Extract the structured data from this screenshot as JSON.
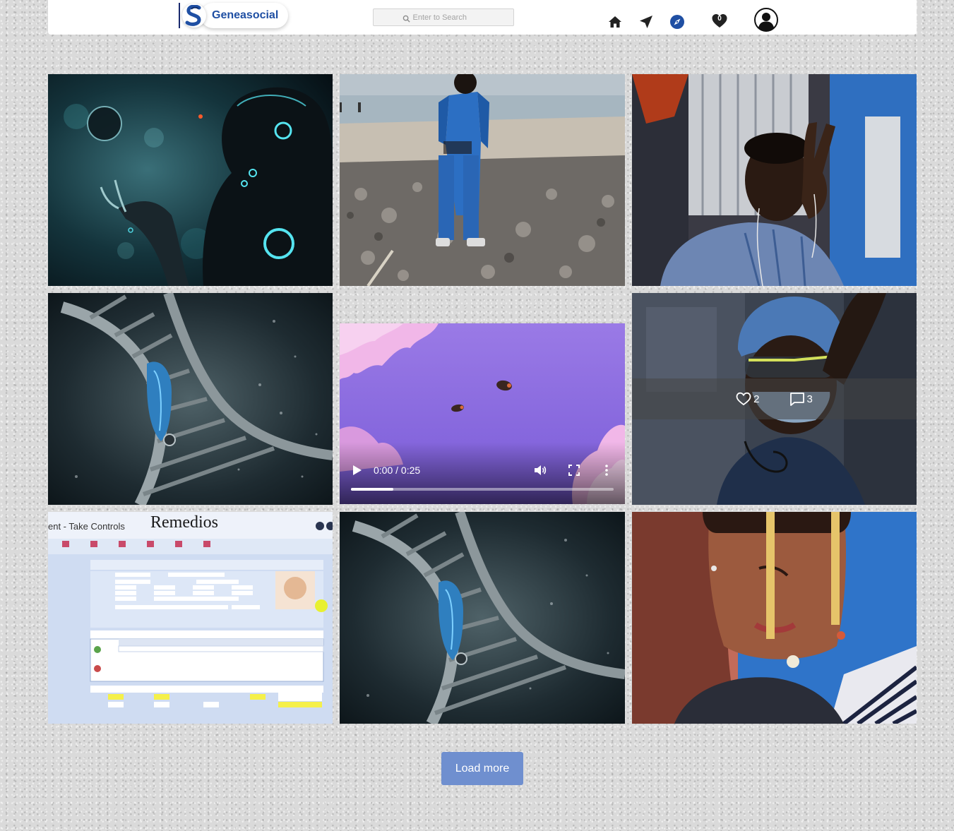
{
  "header": {
    "brand_name": "Geneasocial",
    "search_placeholder": "Enter to Search",
    "nav": [
      {
        "icon": "home-icon"
      },
      {
        "icon": "send-icon"
      },
      {
        "icon": "explore-compass-icon",
        "color": "#1f4fa3"
      },
      {
        "icon": "heart-icon",
        "count": "0"
      },
      {
        "icon": "user-avatar-icon"
      }
    ]
  },
  "grid": {
    "video": {
      "time": "0:00 / 0:25",
      "progress_buffered_fraction": 0.16
    },
    "hover_stats": {
      "likes": "2",
      "comments": "3"
    },
    "screenshot_tile": {
      "title_fragment": "ent - Take Controls",
      "logo": "Remedios"
    }
  },
  "load_more_label": "Load more",
  "colors": {
    "brand_blue": "#1f4fa3",
    "button_blue": "#6f8fcf",
    "background": "#dadada"
  }
}
